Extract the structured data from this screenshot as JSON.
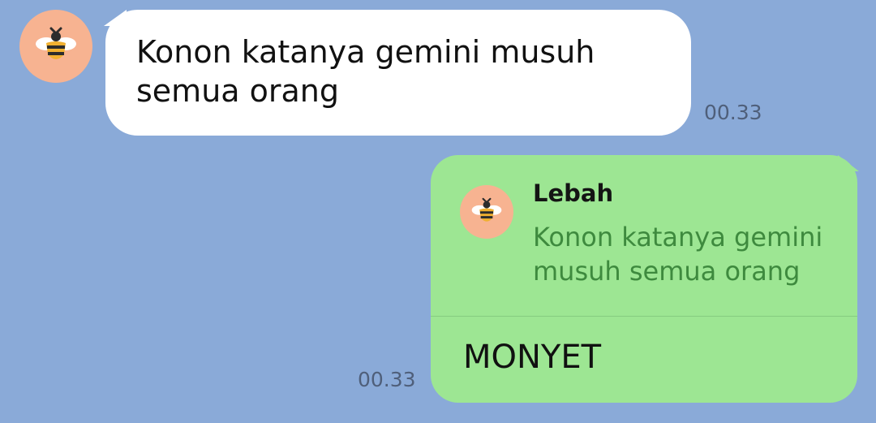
{
  "messages": [
    {
      "direction": "incoming",
      "sender_avatar": "bee-icon",
      "text": "Konon katanya gemini musuh semua orang",
      "time": "00.33"
    },
    {
      "direction": "outgoing",
      "reply_to": {
        "sender": "Lebah",
        "avatar": "bee-icon",
        "text": "Konon katanya gemini musuh semua orang"
      },
      "text": "MONYET",
      "time": "00.33"
    }
  ],
  "colors": {
    "background": "#8aaad8",
    "incoming_bubble": "#ffffff",
    "outgoing_bubble": "#9de693",
    "avatar_bg": "#f7b391",
    "reply_text": "#3e8a3e"
  }
}
